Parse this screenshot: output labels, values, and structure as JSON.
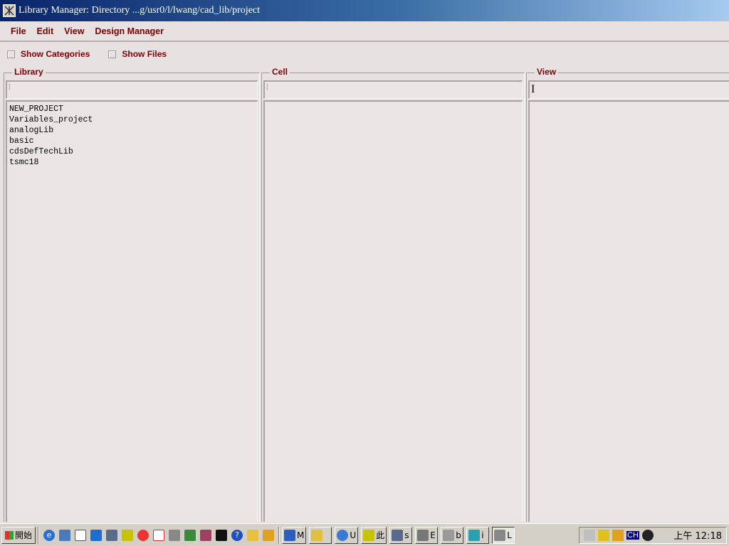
{
  "window": {
    "title": "Library Manager: Directory ...g/usr0/l/lwang/cad_lib/project"
  },
  "menu": {
    "items": [
      {
        "label": "File"
      },
      {
        "label": "Edit"
      },
      {
        "label": "View"
      },
      {
        "label": "Design Manager"
      }
    ]
  },
  "options": {
    "show_categories": {
      "label": "Show Categories",
      "checked": false
    },
    "show_files": {
      "label": "Show Files",
      "checked": false
    }
  },
  "panes": {
    "library": {
      "title": "Library",
      "filter_value": "",
      "items": [
        "NEW_PROJECT",
        "Variables_project",
        "analogLib",
        "basic",
        "cdsDefTechLib",
        "tsmc18"
      ]
    },
    "cell": {
      "title": "Cell",
      "filter_value": "",
      "items": []
    },
    "view": {
      "title": "View",
      "filter_value": "",
      "items": []
    }
  },
  "taskbar": {
    "start_label": "開始",
    "tasks": [
      {
        "label": "M",
        "icon": "network-icon"
      },
      {
        "label": "",
        "icon": "chat-icon"
      },
      {
        "label": "U",
        "icon": "browser-icon"
      },
      {
        "label": "此",
        "icon": "app-icon"
      },
      {
        "label": "s",
        "icon": "terminal-icon"
      },
      {
        "label": "E",
        "icon": "tools-icon"
      },
      {
        "label": "b",
        "icon": "explorer-icon"
      },
      {
        "label": "i",
        "icon": "cross-icon"
      },
      {
        "label": "L",
        "icon": "cadence-icon",
        "active": true
      }
    ],
    "tray": {
      "ime": "CH",
      "clock": "上午 12:18"
    }
  },
  "colors": {
    "label_color": "#800000",
    "background": "#e8e1e2",
    "titlebar_start": "#0a246a",
    "titlebar_end": "#a6caf0"
  }
}
